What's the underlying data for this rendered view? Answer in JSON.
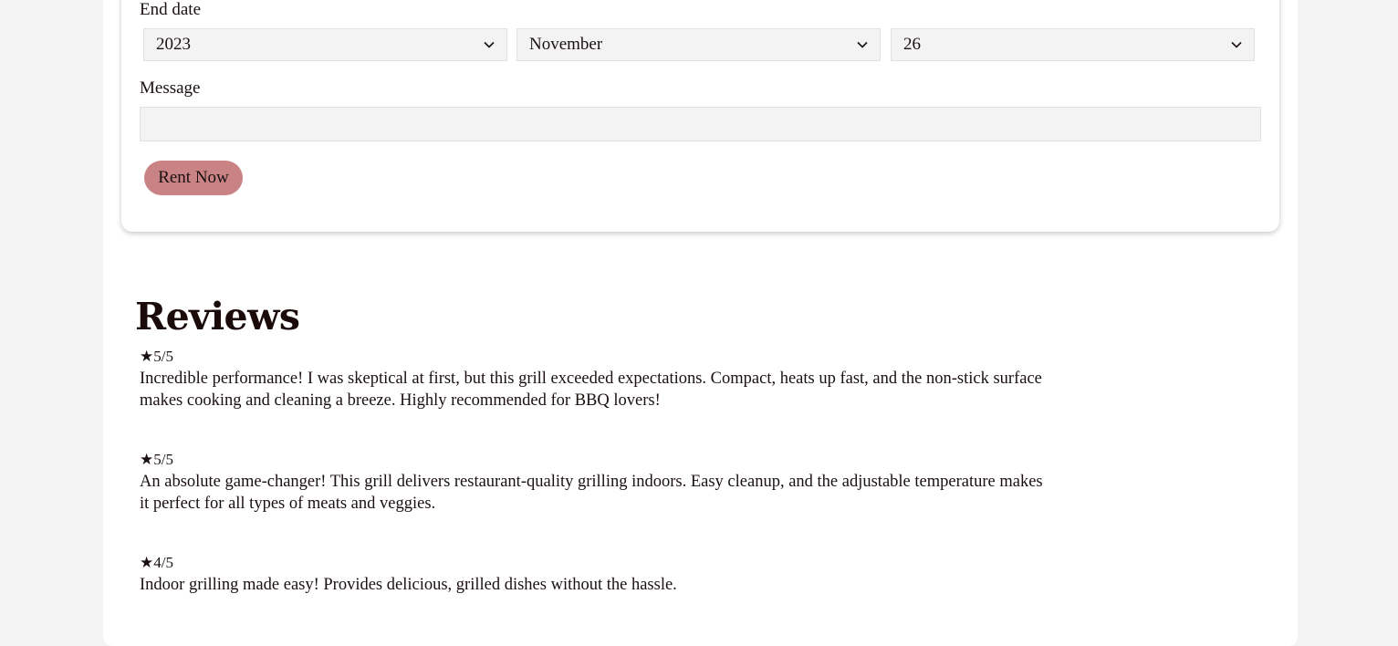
{
  "form": {
    "end_date_label": "End date",
    "year_value": "2023",
    "month_value": "November",
    "day_value": "26",
    "message_label": "Message",
    "message_value": "",
    "submit_label": "Rent Now"
  },
  "reviews": {
    "title": "Reviews",
    "items": [
      {
        "rating": "★5/5",
        "text": "Incredible performance! I was skeptical at first, but this grill exceeded expectations. Compact, heats up fast, and the non-stick surface makes cooking and cleaning a breeze. Highly recommended for BBQ lovers!"
      },
      {
        "rating": "★5/5",
        "text": "An absolute game-changer! This grill delivers restaurant-quality grilling indoors. Easy cleanup, and the adjustable temperature makes it perfect for all types of meats and veggies."
      },
      {
        "rating": "★4/5",
        "text": "Indoor grilling made easy! Provides delicious, grilled dishes without the hassle."
      }
    ]
  },
  "colors": {
    "accent_button": "#c98385",
    "page_background": "#f3f3f3",
    "field_background": "#f3f3f3"
  }
}
